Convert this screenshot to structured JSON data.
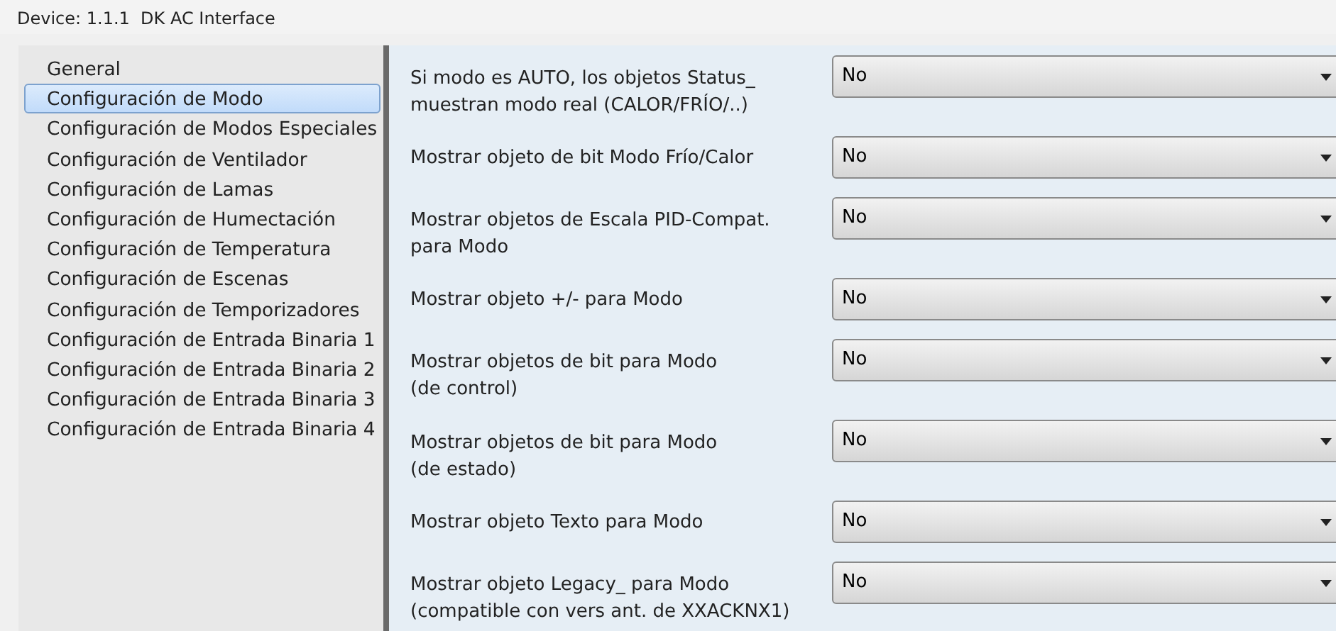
{
  "window": {
    "title": "Device: 1.1.1  DK AC Interface"
  },
  "sidebar": {
    "items": [
      {
        "label": "General",
        "selected": false
      },
      {
        "label": "Configuración de Modo",
        "selected": true
      },
      {
        "label": "Configuración de Modos Especiales",
        "selected": false
      },
      {
        "label": "Configuración de Ventilador",
        "selected": false
      },
      {
        "label": "Configuración de Lamas",
        "selected": false
      },
      {
        "label": "Configuración de Humectación",
        "selected": false
      },
      {
        "label": "Configuración de Temperatura",
        "selected": false
      },
      {
        "label": "Configuración de Escenas",
        "selected": false
      },
      {
        "label": "Configuración de Temporizadores",
        "selected": false
      },
      {
        "label": "Configuración de Entrada Binaria 1",
        "selected": false
      },
      {
        "label": "Configuración de Entrada Binaria 2",
        "selected": false
      },
      {
        "label": "Configuración de Entrada Binaria 3",
        "selected": false
      },
      {
        "label": "Configuración de Entrada Binaria 4",
        "selected": false
      }
    ]
  },
  "parameters": [
    {
      "label": [
        "Si modo es AUTO, los objetos Status_",
        "muestran modo real (CALOR/FRÍO/..)"
      ],
      "value": "No"
    },
    {
      "label": [
        "Mostrar objeto de bit Modo Frío/Calor"
      ],
      "value": "No"
    },
    {
      "label": [
        "Mostrar objetos de Escala PID-Compat.",
        "para Modo"
      ],
      "value": "No"
    },
    {
      "label": [
        "Mostrar objeto +/- para Modo"
      ],
      "value": "No"
    },
    {
      "label": [
        "Mostrar objetos de bit para Modo",
        "(de control)"
      ],
      "value": "No"
    },
    {
      "label": [
        "Mostrar objetos de bit para Modo",
        "(de estado)"
      ],
      "value": "No"
    },
    {
      "label": [
        "Mostrar objeto Texto para Modo"
      ],
      "value": "No"
    },
    {
      "label": [
        "Mostrar objeto Legacy_ para Modo",
        "(compatible con vers ant. de XXACKNX1)"
      ],
      "value": "No"
    }
  ]
}
